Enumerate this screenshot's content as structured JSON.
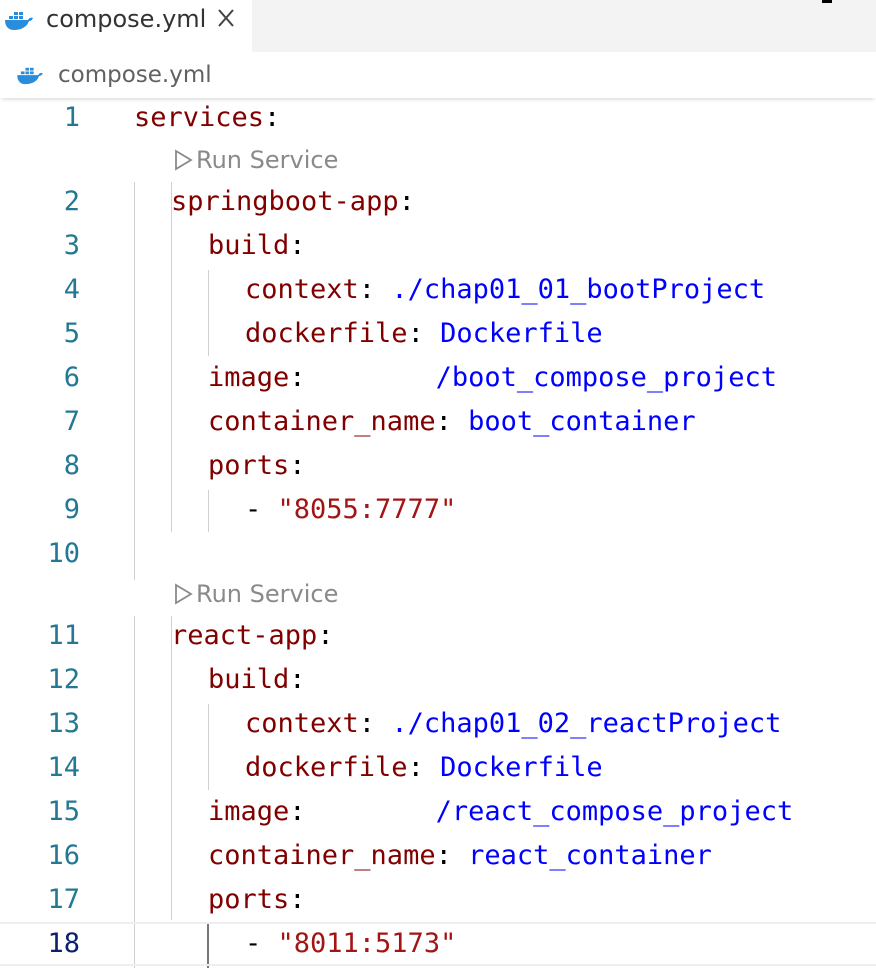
{
  "tab": {
    "title": "compose.yml",
    "icon": "docker-icon",
    "close_icon": "close-icon"
  },
  "breadcrumb": {
    "icon": "docker-icon",
    "label": "compose.yml"
  },
  "codelens": {
    "label": "Run Service",
    "icon": "play-icon"
  },
  "colors": {
    "key": "#800000",
    "value": "#0000ff",
    "string": "#a31515",
    "line_number": "#237893",
    "docker": "#2a8ddb"
  },
  "lines": [
    {
      "n": "1",
      "key": "services",
      "sep": ":",
      "val": ""
    },
    {
      "n": "2",
      "key": "springboot-app",
      "sep": ":",
      "val": ""
    },
    {
      "n": "3",
      "key": "build",
      "sep": ":",
      "val": ""
    },
    {
      "n": "4",
      "key": "context",
      "sep": ": ",
      "val": "./chap01_01_bootProject"
    },
    {
      "n": "5",
      "key": "dockerfile",
      "sep": ": ",
      "val": "Dockerfile"
    },
    {
      "n": "6",
      "key": "image",
      "sep": ":        ",
      "val": "/boot_compose_project"
    },
    {
      "n": "7",
      "key": "container_name",
      "sep": ": ",
      "val": "boot_container"
    },
    {
      "n": "8",
      "key": "ports",
      "sep": ":",
      "val": ""
    },
    {
      "n": "9",
      "dash": "- ",
      "str": "\"8055:7777\""
    },
    {
      "n": "10"
    },
    {
      "n": "11",
      "key": "react-app",
      "sep": ":",
      "val": ""
    },
    {
      "n": "12",
      "key": "build",
      "sep": ":",
      "val": ""
    },
    {
      "n": "13",
      "key": "context",
      "sep": ": ",
      "val": "./chap01_02_reactProject"
    },
    {
      "n": "14",
      "key": "dockerfile",
      "sep": ": ",
      "val": "Dockerfile"
    },
    {
      "n": "15",
      "key": "image",
      "sep": ":        ",
      "val": "/react_compose_project"
    },
    {
      "n": "16",
      "key": "container_name",
      "sep": ": ",
      "val": "react_container"
    },
    {
      "n": "17",
      "key": "ports",
      "sep": ":",
      "val": ""
    },
    {
      "n": "18",
      "dash": "- ",
      "str": "\"8011:5173\""
    }
  ]
}
